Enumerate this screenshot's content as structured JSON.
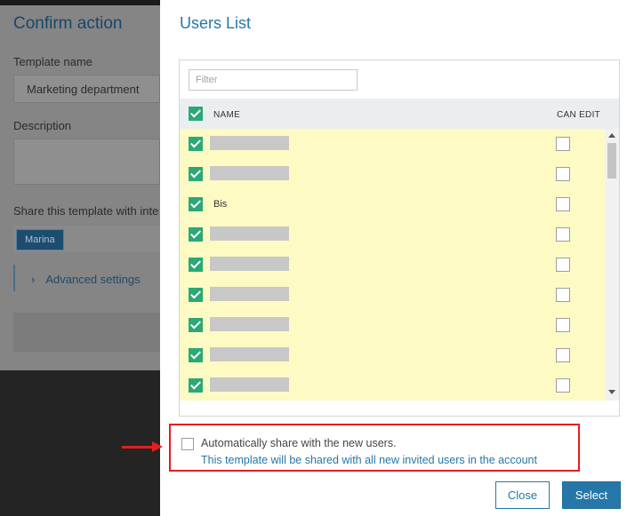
{
  "background_form": {
    "title": "Confirm action",
    "template_name_label": "Template name",
    "template_name_value": "Marketing department",
    "description_label": "Description",
    "share_label": "Share this template with inte",
    "shared_chip": "Marina",
    "advanced_settings": "Advanced settings",
    "advanced_chevron": "›"
  },
  "modal": {
    "title": "Users List",
    "filter_placeholder": "Filter",
    "columns": {
      "name": "NAME",
      "can_edit": "CAN EDIT"
    },
    "header_checked": true,
    "rows": [
      {
        "name": "",
        "redacted": true,
        "checked": true,
        "can_edit": false
      },
      {
        "name": "",
        "redacted": true,
        "checked": true,
        "can_edit": false
      },
      {
        "name": "Bis",
        "redacted": false,
        "checked": true,
        "can_edit": false
      },
      {
        "name": "",
        "redacted": true,
        "checked": true,
        "can_edit": false
      },
      {
        "name": "",
        "redacted": true,
        "checked": true,
        "can_edit": false
      },
      {
        "name": "",
        "redacted": true,
        "checked": true,
        "can_edit": false
      },
      {
        "name": "",
        "redacted": true,
        "checked": true,
        "can_edit": false
      },
      {
        "name": "",
        "redacted": true,
        "checked": true,
        "can_edit": false
      },
      {
        "name": "",
        "redacted": true,
        "checked": true,
        "can_edit": false
      }
    ],
    "auto_share": {
      "checked": false,
      "title": "Automatically share with the new users.",
      "description": "This template will be shared with all new invited users in the account"
    },
    "buttons": {
      "close": "Close",
      "select": "Select"
    }
  },
  "colors": {
    "accent": "#2677a8",
    "check_green": "#2aa876",
    "row_highlight": "#fdfac4",
    "annotation_red": "#e41e1e"
  }
}
